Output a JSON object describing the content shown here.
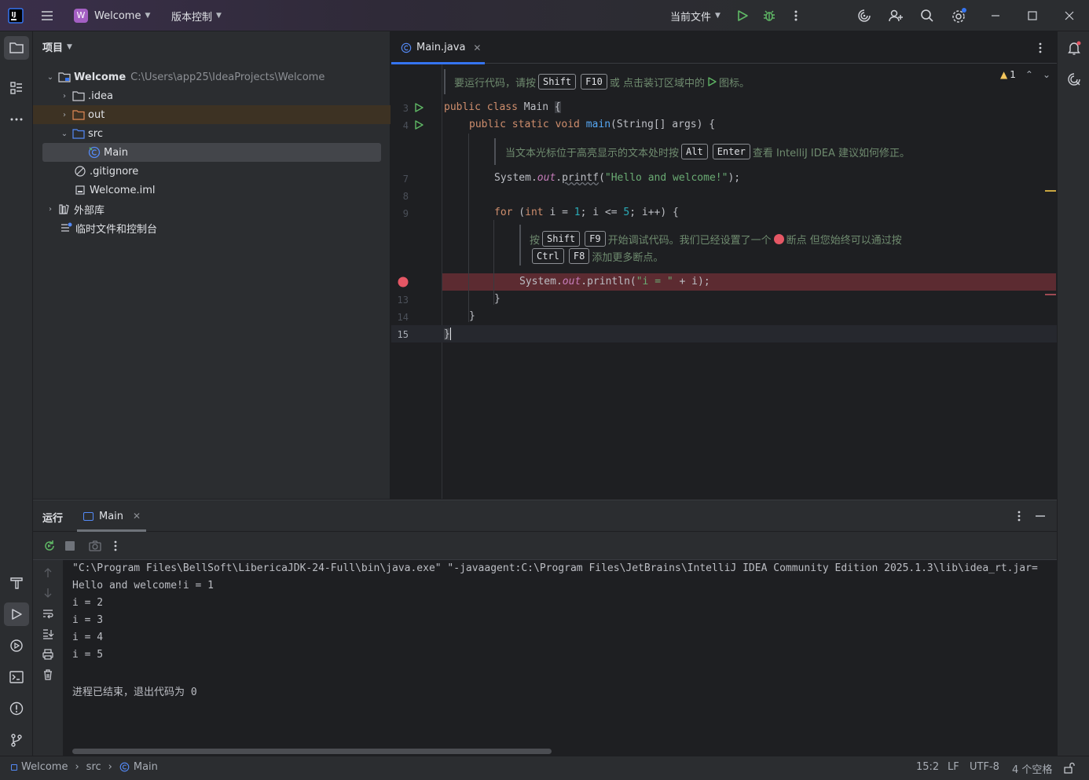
{
  "titlebar": {
    "project_name": "Welcome",
    "project_badge": "W",
    "vcs_label": "版本控制",
    "run_config": "当前文件"
  },
  "project_panel": {
    "title": "项目",
    "root_name": "Welcome",
    "root_path": "C:\\Users\\app25\\IdeaProjects\\Welcome",
    "items": [
      {
        "label": ".idea"
      },
      {
        "label": "out"
      },
      {
        "label": "src"
      },
      {
        "label": "Main"
      },
      {
        "label": ".gitignore"
      },
      {
        "label": "Welcome.iml"
      },
      {
        "label": "外部库"
      },
      {
        "label": "临时文件和控制台"
      }
    ]
  },
  "editor": {
    "tab_label": "Main.java",
    "warnings_count": "1",
    "line_numbers": [
      "3",
      "4",
      "7",
      "8",
      "9",
      "13",
      "14",
      "15"
    ],
    "hint1": {
      "before": "要运行代码，请按",
      "k1": "Shift",
      "k2": "F10",
      "after": "或 点击装订区域中的",
      "icon_after": "图标。"
    },
    "hint2": {
      "before": "当文本光标位于高亮显示的文本处时按",
      "k1": "Alt",
      "k2": "Enter",
      "after": "查看 IntelliJ IDEA 建议如何修正。"
    },
    "hint3": {
      "before": "按",
      "k1": "Shift",
      "k2": "F9",
      "after": "开始调试代码。我们已经设置了一个",
      "after2": "断点 但您始终可以通过按",
      "k3": "Ctrl",
      "k4": "F8",
      "end": "添加更多断点。"
    },
    "code": {
      "l3_kw": "public class",
      "l3_name": " Main ",
      "l3_brace": "{",
      "l4_kw": "public static void",
      "l4_fn": "main",
      "l4_rest": "(String[] args) {",
      "l7_a": "System.",
      "l7_field": "out",
      "l7_b": ".",
      "l7_fn": "printf",
      "l7_c": "(",
      "l7_str": "\"Hello and welcome!\"",
      "l7_d": ");",
      "l9_for": "for",
      "l9_a": " (",
      "l9_int": "int",
      "l9_b": " i = ",
      "l9_one": "1",
      "l9_c": "; i <= ",
      "l9_five": "5",
      "l9_d": "; i++) {",
      "l12_a": "System.",
      "l12_field": "out",
      "l12_b": ".println(",
      "l12_str": "\"i = \"",
      "l12_c": " + i);",
      "l13": "}",
      "l14": "}",
      "l15": "}"
    }
  },
  "run_panel": {
    "title": "运行",
    "tab_label": "Main",
    "output": [
      "\"C:\\Program Files\\BellSoft\\LibericaJDK-24-Full\\bin\\java.exe\" \"-javaagent:C:\\Program Files\\JetBrains\\IntelliJ IDEA Community Edition 2025.1.3\\lib\\idea_rt.jar=",
      "Hello and welcome!i = 1",
      "i = 2",
      "i = 3",
      "i = 4",
      "i = 5",
      "",
      "进程已结束，退出代码为 0"
    ]
  },
  "statusbar": {
    "crumbs": [
      "Welcome",
      "src",
      "Main"
    ],
    "position": "15:2",
    "line_sep": "LF",
    "encoding": "UTF-8",
    "indent": "4 个空格"
  },
  "colors": {
    "accent": "#3574f0",
    "run_green": "#5fb865",
    "breakpoint": "#e55765",
    "project_badge": "#a45fc3"
  }
}
